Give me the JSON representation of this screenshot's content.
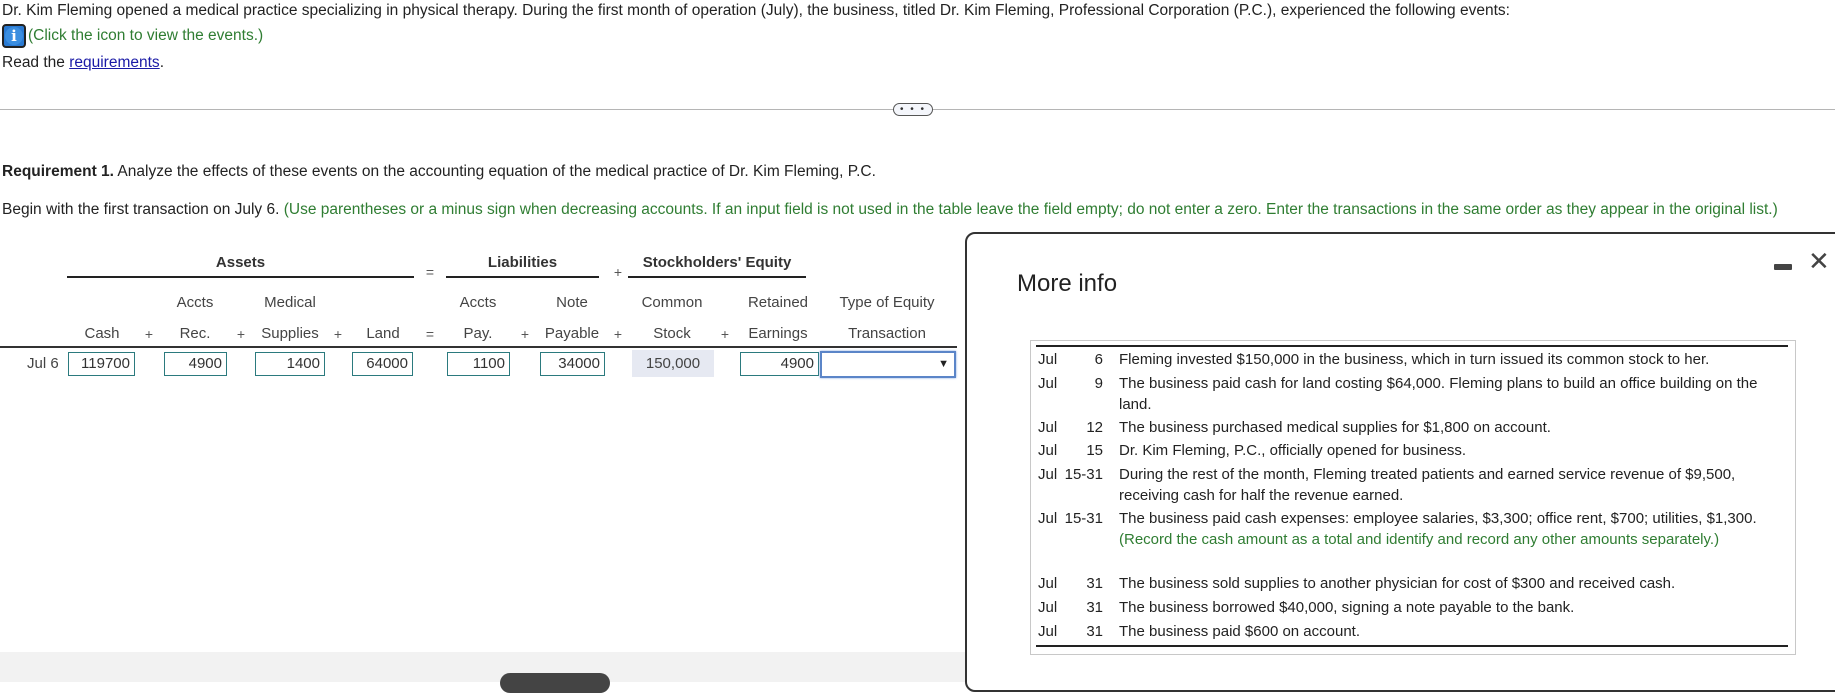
{
  "intro": {
    "text": "Dr. Kim Fleming opened a medical practice specializing in physical therapy. During the first month of operation (July), the business, titled Dr. Kim Fleming, Professional Corporation (P.C.), experienced the following events:",
    "info_hint": "(Click the icon to view the events.)",
    "read_prefix": "Read the ",
    "requirements_link": "requirements",
    "read_suffix": "."
  },
  "divider_button": "• • •",
  "requirement": {
    "label": "Requirement 1.",
    "text": " Analyze the effects of these events on the accounting equation of the medical practice of Dr. Kim Fleming, P.C.",
    "begin": "Begin with the first transaction on July 6. ",
    "instructions": "(Use parentheses or a minus sign when decreasing accounts. If an input field is not used in the table leave the field empty; do not enter a zero. Enter the transactions in the same order as they appear in the original list.)"
  },
  "equation": {
    "groups": {
      "assets": "Assets",
      "liabilities": "Liabilities",
      "equity": "Stockholders' Equity"
    },
    "operators": {
      "plus": "+",
      "equals": "="
    },
    "columns": {
      "cash": [
        "",
        "Cash"
      ],
      "accts_rec": [
        "Accts",
        "Rec."
      ],
      "medical_supplies": [
        "Medical",
        "Supplies"
      ],
      "land": [
        "",
        "Land"
      ],
      "accts_pay": [
        "Accts",
        "Pay."
      ],
      "note_payable": [
        "Note",
        "Payable"
      ],
      "common_stock": [
        "Common",
        "Stock"
      ],
      "retained_earnings": [
        "Retained",
        "Earnings"
      ],
      "type_of_equity": [
        "Type of Equity",
        "Transaction"
      ]
    },
    "rows": [
      {
        "label": "Jul 6",
        "cash": "119700",
        "accts_rec": "4900",
        "medical_supplies": "1400",
        "land": "64000",
        "accts_pay": "1100",
        "note_payable": "34000",
        "common_stock": "150,000",
        "retained_earnings": "4900",
        "type_of_equity": ""
      }
    ]
  },
  "modal": {
    "title": "More info",
    "minimize_icon": "minimize",
    "close_icon": "close",
    "events": [
      {
        "month": "Jul",
        "day": "6",
        "text": "Fleming invested $150,000 in the business, which in turn issued its common stock to her.",
        "note": ""
      },
      {
        "month": "Jul",
        "day": "9",
        "text": "The business paid cash for land costing $64,000. Fleming plans to build an office building on the land.",
        "note": ""
      },
      {
        "month": "Jul",
        "day": "12",
        "text": "The business purchased medical supplies for $1,800 on account.",
        "note": ""
      },
      {
        "month": "Jul",
        "day": "15",
        "text": "Dr. Kim Fleming, P.C., officially opened for business.",
        "note": ""
      },
      {
        "month": "Jul",
        "day": "15-31",
        "text": "During the rest of the month, Fleming treated patients and earned service revenue of $9,500, receiving cash for half the revenue earned.",
        "note": ""
      },
      {
        "month": "Jul",
        "day": "15-31",
        "text": "The business paid cash expenses: employee salaries, $3,300; office rent, $700; utilities, $1,300. ",
        "note": "(Record the cash amount as a total and identify and record any other amounts separately.)"
      },
      {
        "month": "Jul",
        "day": "31",
        "text": "The business sold supplies to another physician for cost of $300 and received cash.",
        "note": ""
      },
      {
        "month": "Jul",
        "day": "31",
        "text": "The business borrowed $40,000, signing a note payable to the bank.",
        "note": ""
      },
      {
        "month": "Jul",
        "day": "31",
        "text": "The business paid $600 on account.",
        "note": ""
      }
    ]
  },
  "colors": {
    "instruction_green": "#2f7d32",
    "link_blue": "#1a1aa6",
    "input_border": "#2b7a7e",
    "select_focus": "#5b85c8",
    "static_cell_bg": "#e6e9f2"
  }
}
